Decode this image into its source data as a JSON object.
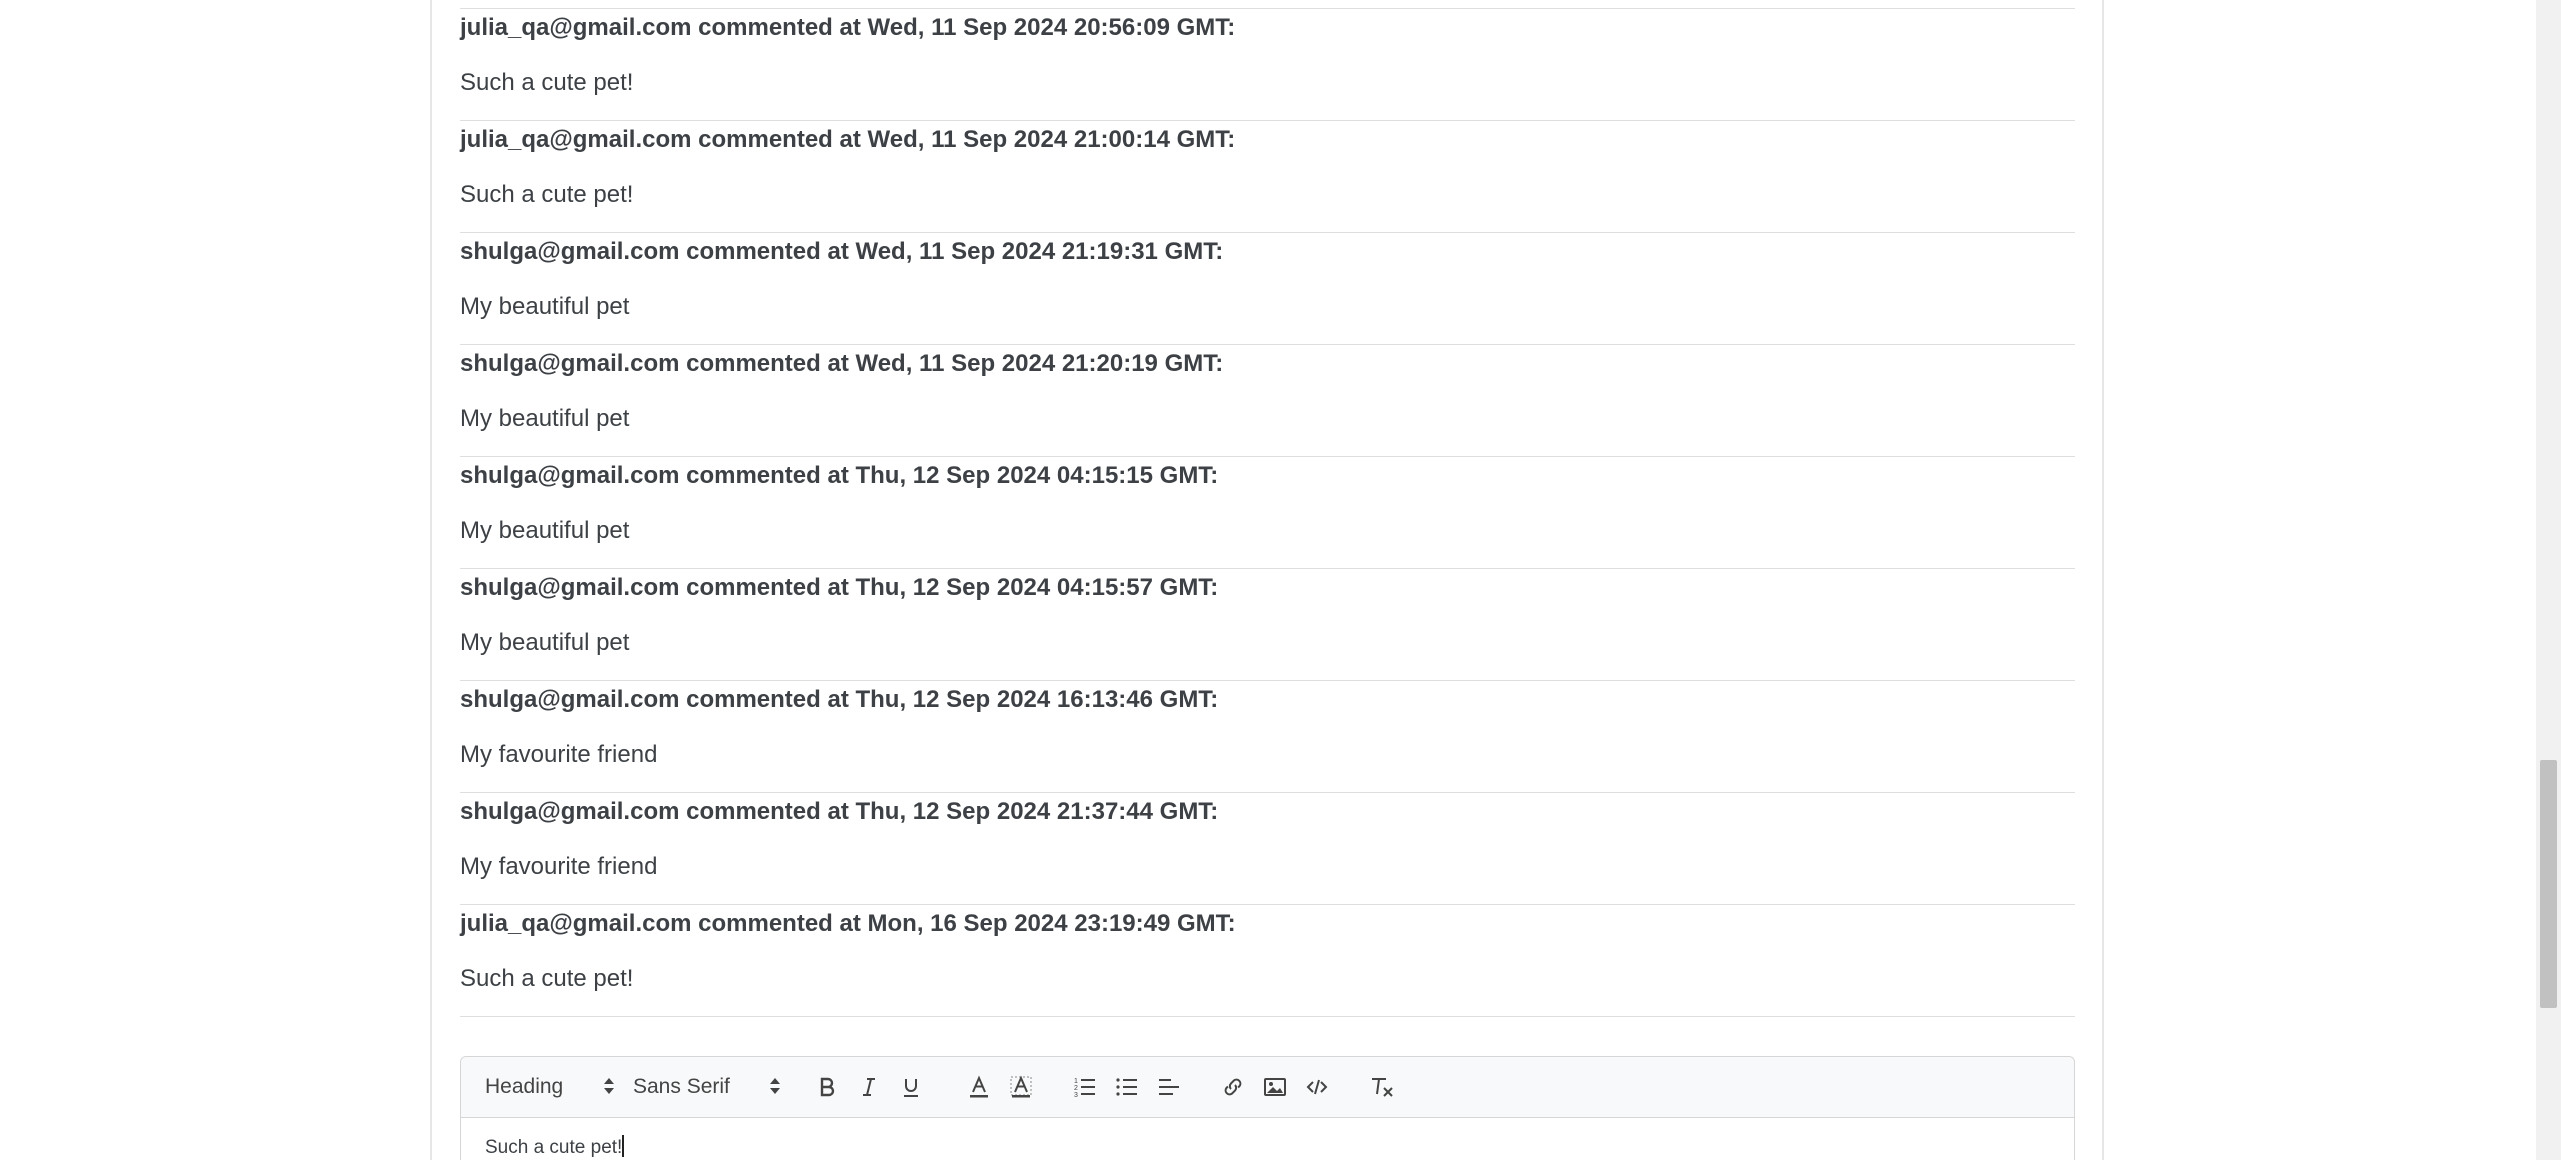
{
  "comments": [
    {
      "header": "julia_qa@gmail.com commented at Wed, 11 Sep 2024 20:56:09 GMT:",
      "text": "Such a cute pet!"
    },
    {
      "header": "julia_qa@gmail.com commented at Wed, 11 Sep 2024 21:00:14 GMT:",
      "text": "Such a cute pet!"
    },
    {
      "header": "shulga@gmail.com commented at Wed, 11 Sep 2024 21:19:31 GMT:",
      "text": "My beautiful pet"
    },
    {
      "header": "shulga@gmail.com commented at Wed, 11 Sep 2024 21:20:19 GMT:",
      "text": "My beautiful pet"
    },
    {
      "header": "shulga@gmail.com commented at Thu, 12 Sep 2024 04:15:15 GMT:",
      "text": "My beautiful pet"
    },
    {
      "header": "shulga@gmail.com commented at Thu, 12 Sep 2024 04:15:57 GMT:",
      "text": "My beautiful pet"
    },
    {
      "header": "shulga@gmail.com commented at Thu, 12 Sep 2024 16:13:46 GMT:",
      "text": "My favourite friend"
    },
    {
      "header": "shulga@gmail.com commented at Thu, 12 Sep 2024 21:37:44 GMT:",
      "text": "My favourite friend"
    },
    {
      "header": "julia_qa@gmail.com commented at Mon, 16 Sep 2024 23:19:49 GMT:",
      "text": "Such a cute pet!"
    }
  ],
  "editor": {
    "heading_picker": "Heading",
    "font_picker": "Sans Serif",
    "content": "Such a cute pet!",
    "icons": [
      "bold-icon",
      "italic-icon",
      "underline-icon",
      "text-color-icon",
      "background-color-icon",
      "ordered-list-icon",
      "bullet-list-icon",
      "align-icon",
      "link-icon",
      "image-icon",
      "code-icon",
      "clear-format-icon"
    ]
  }
}
